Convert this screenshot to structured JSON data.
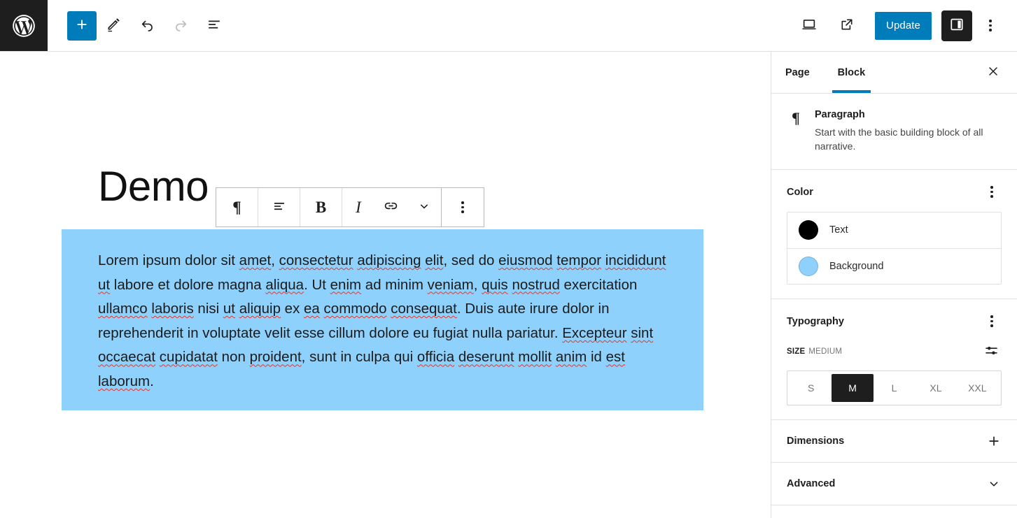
{
  "header": {
    "logo_icon": "wordpress-logo-icon",
    "left_tools": [
      {
        "name": "add-block-button",
        "icon": "plus-icon",
        "label": "Add block",
        "state": "primary"
      },
      {
        "name": "tools-edit-button",
        "icon": "pencil-icon",
        "label": "Edit",
        "state": "default"
      },
      {
        "name": "undo-button",
        "icon": "undo-arrow-icon",
        "label": "Undo",
        "state": "default"
      },
      {
        "name": "redo-button",
        "icon": "redo-arrow-icon",
        "label": "Redo",
        "state": "disabled"
      },
      {
        "name": "list-view-button",
        "icon": "list-view-icon",
        "label": "Document Overview",
        "state": "default"
      }
    ],
    "right_tools": [
      {
        "name": "preview-button",
        "icon": "laptop-icon",
        "label": "View"
      },
      {
        "name": "view-site-button",
        "icon": "external-link-icon",
        "label": "Preview in new tab"
      }
    ],
    "update_label": "Update",
    "settings_toggle_icon": "sidebar-panel-icon",
    "options_icon": "kebab-menu-icon"
  },
  "canvas": {
    "post_title": "Demo",
    "paragraph": "Lorem ipsum dolor sit amet, consectetur adipiscing elit, sed do eiusmod tempor incididunt ut labore et dolore magna aliqua. Ut enim ad minim veniam, quis nostrud exercitation ullamco laboris nisi ut aliquip ex ea commodo consequat. Duis aute irure dolor in reprehenderit in voluptate velit esse cillum dolore eu fugiat nulla pariatur. Excepteur sint occaecat cupidatat non proident, sunt in culpa qui officia deserunt mollit anim id est laborum.",
    "paragraph_background_color": "#8ed1fc",
    "paragraph_text_color": "#1b1b1b"
  },
  "block_toolbar": {
    "items": [
      {
        "name": "block-type-button",
        "icon": "paragraph-pilcrow-icon",
        "label": "Paragraph",
        "glyph": "¶"
      },
      {
        "name": "align-text-button",
        "icon": "align-text-icon",
        "label": "Align text",
        "glyph": ""
      },
      {
        "name": "bold-button",
        "icon": "bold-icon",
        "label": "Bold",
        "glyph": "B"
      },
      {
        "name": "italic-button",
        "icon": "italic-icon",
        "label": "Italic",
        "glyph": "I"
      },
      {
        "name": "link-button",
        "icon": "link-icon",
        "label": "Link",
        "glyph": ""
      },
      {
        "name": "more-rich-text-button",
        "icon": "chevron-down-icon",
        "label": "More",
        "glyph": ""
      },
      {
        "name": "block-options-button",
        "icon": "kebab-menu-icon",
        "label": "Options",
        "glyph": ""
      }
    ]
  },
  "sidebar": {
    "tabs": [
      {
        "label": "Page",
        "active": false
      },
      {
        "label": "Block",
        "active": true
      }
    ],
    "close_icon": "close-icon",
    "block_card": {
      "icon": "paragraph-pilcrow-icon",
      "icon_glyph": "¶",
      "name": "Paragraph",
      "description": "Start with the basic building block of all narrative."
    },
    "color_panel": {
      "title": "Color",
      "options_icon": "kebab-menu-icon",
      "rows": [
        {
          "label": "Text",
          "swatch": "#000000"
        },
        {
          "label": "Background",
          "swatch": "#8ed1fc"
        }
      ]
    },
    "typography_panel": {
      "title": "Typography",
      "options_icon": "kebab-menu-icon",
      "size_key": "SIZE",
      "size_value": "MEDIUM",
      "sliders_icon": "sliders-icon",
      "sizes": [
        {
          "label": "S",
          "selected": false
        },
        {
          "label": "M",
          "selected": true
        },
        {
          "label": "L",
          "selected": false
        },
        {
          "label": "XL",
          "selected": false
        },
        {
          "label": "XXL",
          "selected": false
        }
      ]
    },
    "collapsed_panels": [
      {
        "title": "Dimensions",
        "icon": "plus-icon"
      },
      {
        "title": "Advanced",
        "icon": "chevron-down-icon"
      }
    ]
  },
  "theme": {
    "accent": "#007cba",
    "dark": "#1e1e1e",
    "border": "#e0e0e0",
    "spellcheck_underline": "#ee3322"
  }
}
